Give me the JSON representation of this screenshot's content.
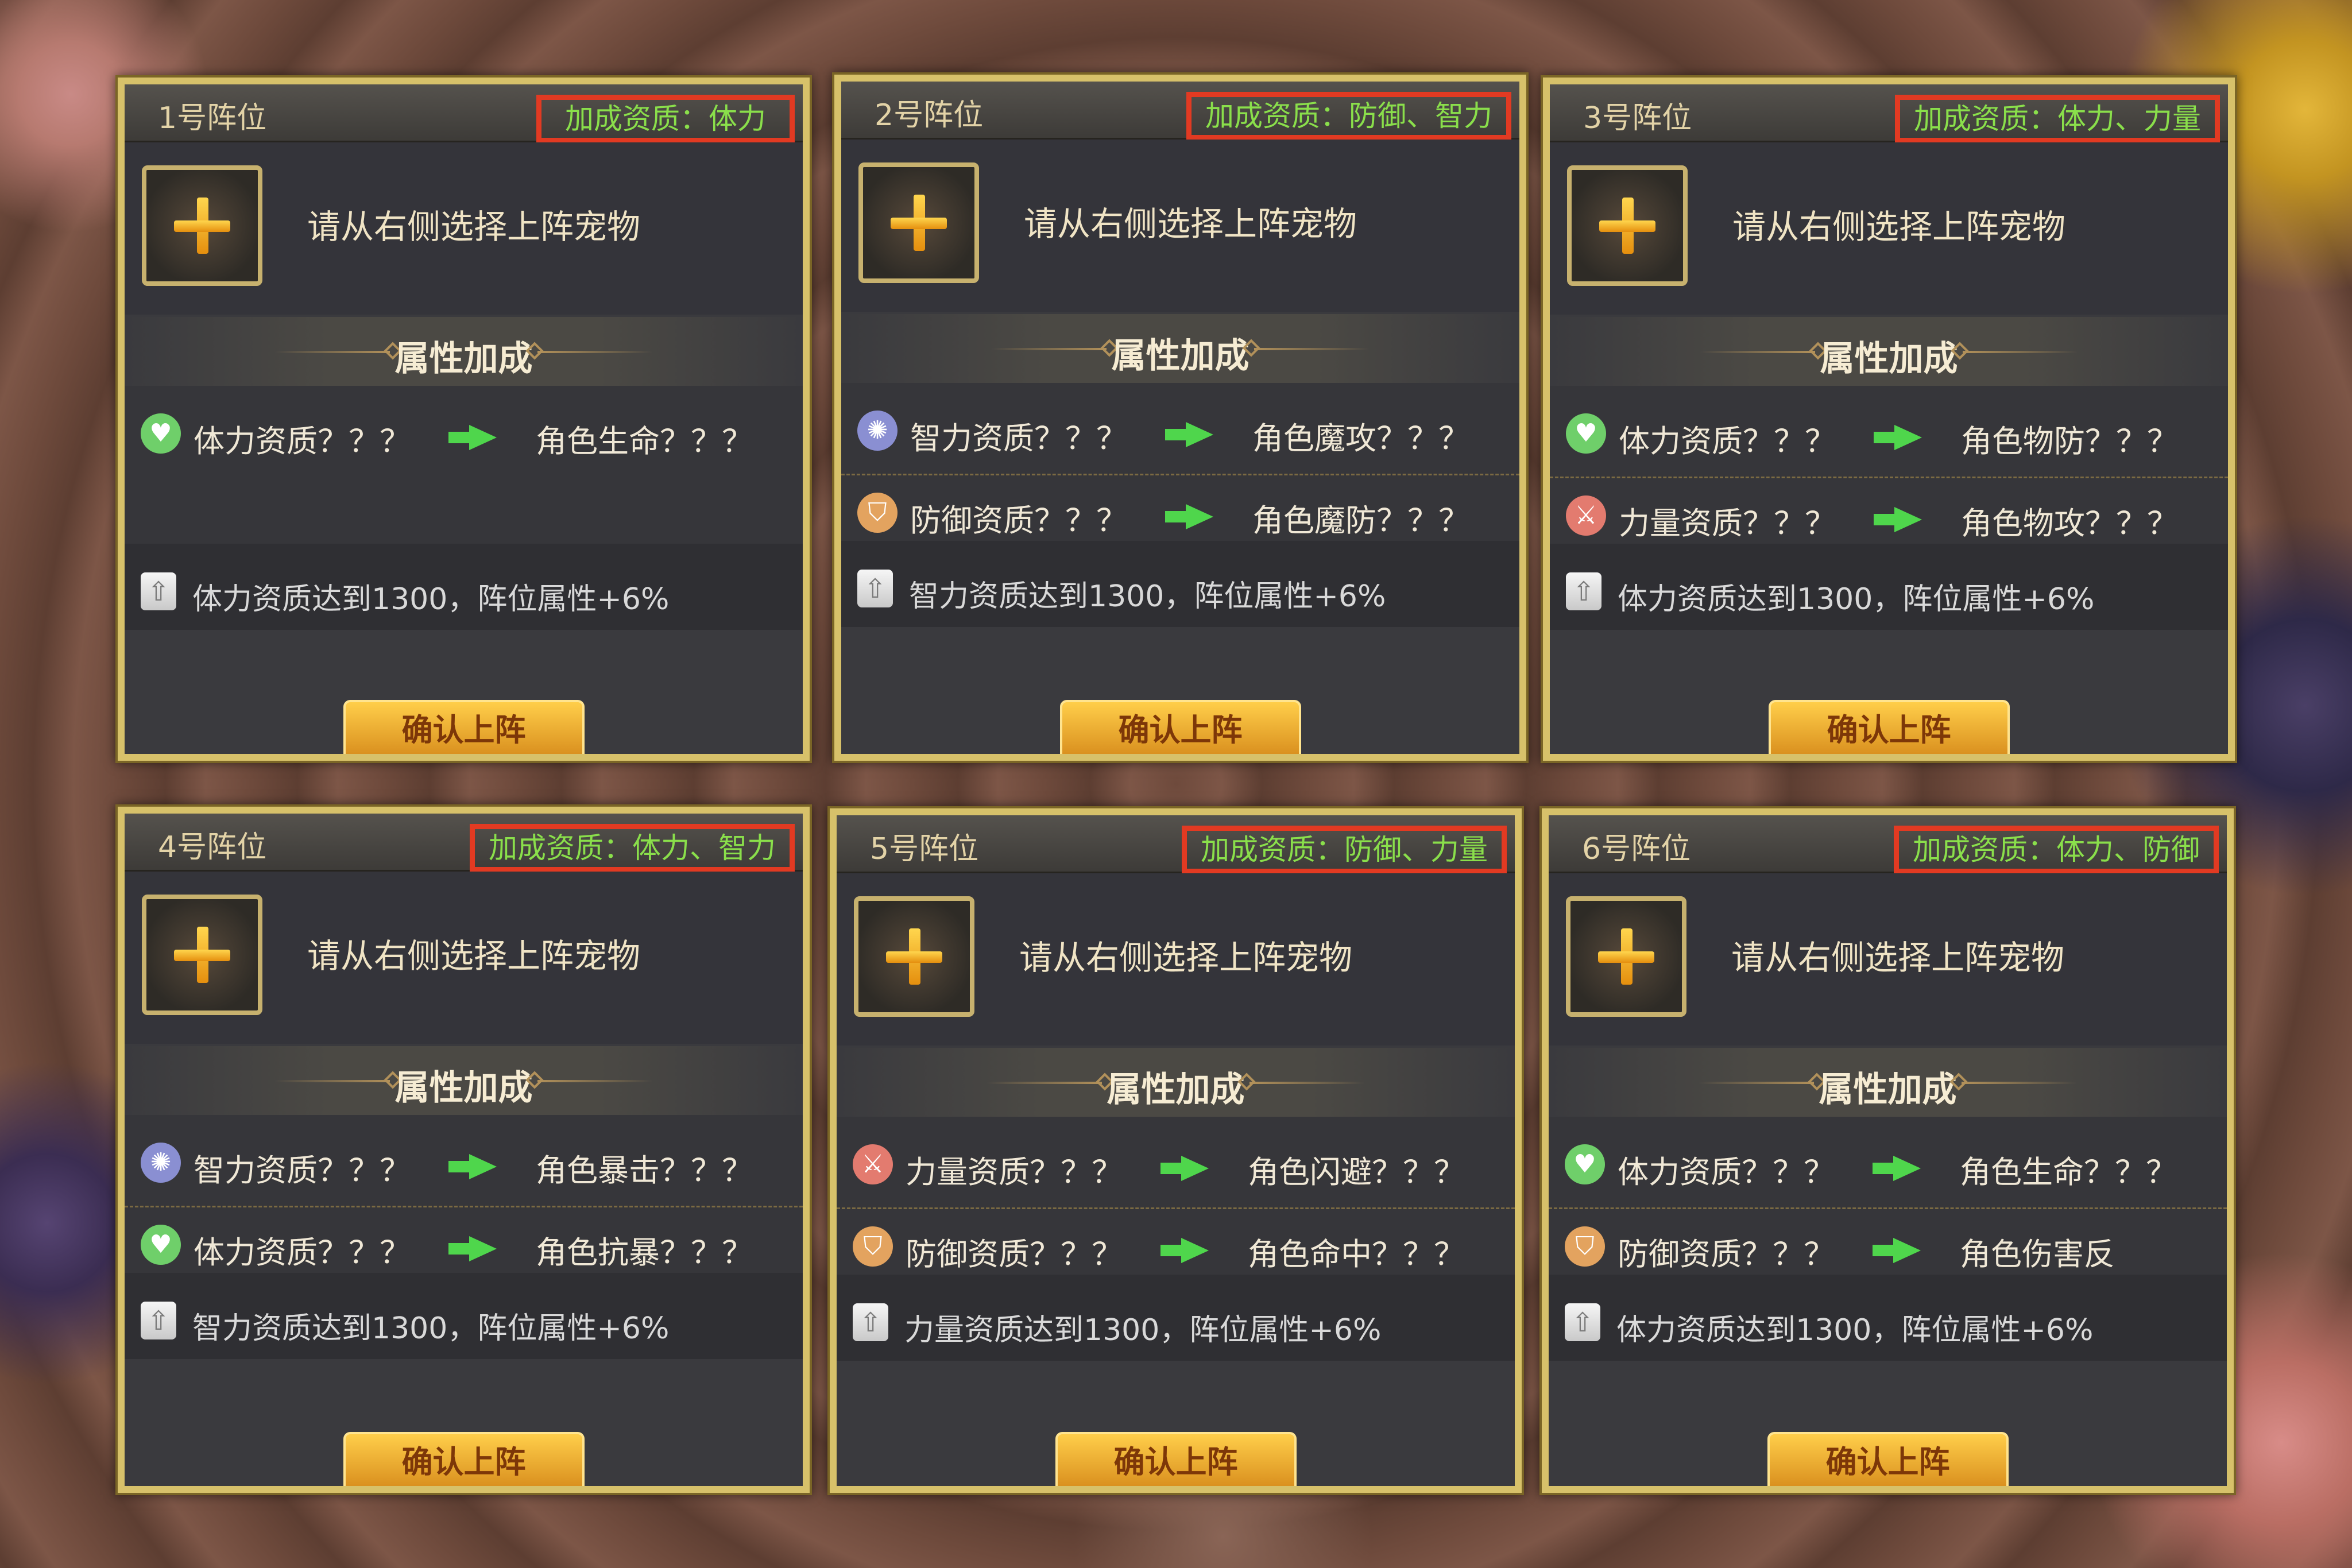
{
  "pick_prompt": "请从右侧选择上阵宠物",
  "section_title": "属性加成",
  "confirm_label": "确认上阵",
  "colors": {
    "bonus_text": "#8adf4b",
    "highlight_box": "#e23a22",
    "frame_gold": "#d7c16a",
    "arrow": "#4fd64c"
  },
  "panels": [
    {
      "slot": "1号阵位",
      "bonus": "加成资质：体力",
      "rows": [
        {
          "icon": "heart-icon",
          "attr": "体力资质？？？",
          "result": "角色生命？？？"
        }
      ],
      "requirement": "体力资质达到1300，阵位属性+6%"
    },
    {
      "slot": "2号阵位",
      "bonus": "加成资质：防御、智力",
      "rows": [
        {
          "icon": "star-icon",
          "attr": "智力资质？？？",
          "result": "角色魔攻？？？"
        },
        {
          "icon": "shield-icon",
          "attr": "防御资质？？？",
          "result": "角色魔防？？？"
        }
      ],
      "requirement": "智力资质达到1300，阵位属性+6%"
    },
    {
      "slot": "3号阵位",
      "bonus": "加成资质：体力、力量",
      "rows": [
        {
          "icon": "heart-icon",
          "attr": "体力资质？？？",
          "result": "角色物防？？？"
        },
        {
          "icon": "sword-icon",
          "attr": "力量资质？？？",
          "result": "角色物攻？？？"
        }
      ],
      "requirement": "体力资质达到1300，阵位属性+6%"
    },
    {
      "slot": "4号阵位",
      "bonus": "加成资质：体力、智力",
      "rows": [
        {
          "icon": "star-icon",
          "attr": "智力资质？？？",
          "result": "角色暴击？？？"
        },
        {
          "icon": "heart-icon",
          "attr": "体力资质？？？",
          "result": "角色抗暴？？？"
        }
      ],
      "requirement": "智力资质达到1300，阵位属性+6%"
    },
    {
      "slot": "5号阵位",
      "bonus": "加成资质：防御、力量",
      "rows": [
        {
          "icon": "sword-icon",
          "attr": "力量资质？？？",
          "result": "角色闪避？？？"
        },
        {
          "icon": "shield-icon",
          "attr": "防御资质？？？",
          "result": "角色命中？？？"
        }
      ],
      "requirement": "力量资质达到1300，阵位属性+6%"
    },
    {
      "slot": "6号阵位",
      "bonus": "加成资质：体力、防御",
      "rows": [
        {
          "icon": "heart-icon",
          "attr": "体力资质？？？",
          "result": "角色生命？？？"
        },
        {
          "icon": "shield-icon",
          "attr": "防御资质？？？",
          "result": "角色伤害反弹？？？"
        }
      ],
      "requirement": "体力资质达到1300，阵位属性+6%"
    }
  ]
}
